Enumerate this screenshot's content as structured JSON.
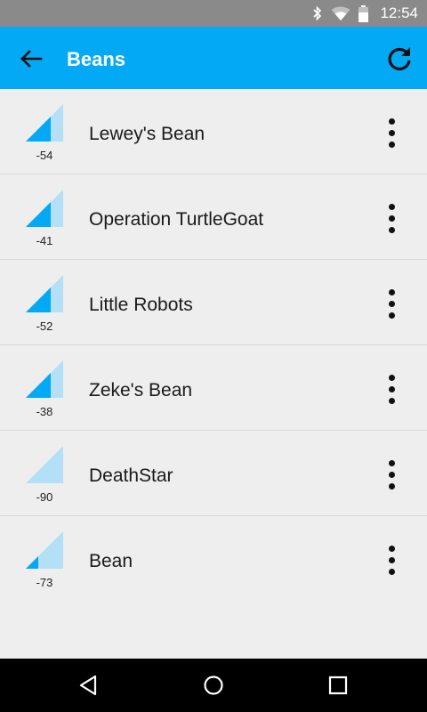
{
  "status_bar": {
    "time": "12:54",
    "icons": [
      "bluetooth-icon",
      "wifi-icon",
      "battery-icon"
    ]
  },
  "app_bar": {
    "title": "Beans",
    "back_icon": "arrow-back-icon",
    "refresh_icon": "refresh-icon",
    "color": "#03a9f4"
  },
  "beans": [
    {
      "name": "Lewey's Bean",
      "rssi": "-54",
      "level": 2
    },
    {
      "name": "Operation TurtleGoat",
      "rssi": "-41",
      "level": 3
    },
    {
      "name": "Little Robots",
      "rssi": "-52",
      "level": 3
    },
    {
      "name": "Zeke's Bean",
      "rssi": "-38",
      "level": 3
    },
    {
      "name": "DeathStar",
      "rssi": "-90",
      "level": 0
    },
    {
      "name": "Bean",
      "rssi": "-73",
      "level": 1
    }
  ],
  "signal_colors": {
    "active": "#03a9f4",
    "inactive": "#b3e0f7"
  },
  "nav_bar": {
    "icons": [
      "nav-back-icon",
      "nav-home-icon",
      "nav-recents-icon"
    ]
  }
}
